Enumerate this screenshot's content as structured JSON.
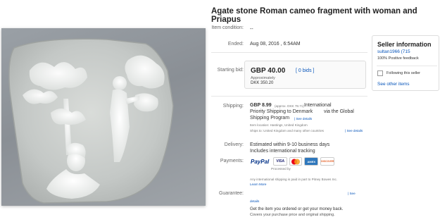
{
  "listing": {
    "title": "Agate stone Roman cameo fragment with woman and Priapus",
    "image_alt": "Agate cameo fragment photo"
  },
  "details": {
    "condition_label": "Item condition:",
    "condition_value": "--",
    "ended_label": "Ended:",
    "ended_value": "Aug 08, 2016 , 6:54AM",
    "starting_bid_label": "Starting bid:",
    "price": "GBP 40.00",
    "approx_label": "Approximately",
    "dkk_price": "DKK 350.20",
    "bids_link": "[ 0 bids ]",
    "shipping_label": "Shipping:",
    "shipping_price": "GBP 8.99",
    "shipping_approx": "(approx. DKK 78.71)",
    "shipping_desc_1": "International",
    "shipping_desc_2": "Priority Shipping to Denmark",
    "shipping_desc_3": "via the Global",
    "shipping_desc_4": "Shipping Program",
    "shipping_details_link": "| See details",
    "item_location": "Item location: Hastings, United Kingdom",
    "ships_to": "Ships to: United Kingdom and many other countries",
    "ships_to_link": "| See details",
    "delivery_label": "Delivery:",
    "delivery_value": "Estimated within 9-10 business days",
    "delivery_tracking": "Includes international tracking",
    "payments_label": "Payments:",
    "paypal": "PayPal",
    "processed_by": "Processed by",
    "pitney_note": "Any international shipping is paid in part to Pitney Bowes Inc.",
    "learn_more": "Learn More",
    "guarantee_label": "Guarantee:",
    "guarantee_see": "| See",
    "guarantee_details": "details",
    "guarantee_text_1": "Get the item you ordered or get your money back.",
    "guarantee_text_2": "Covers your purchase price and original shipping."
  },
  "seller": {
    "title": "Seller information",
    "name": "sultan1966 (715",
    "feedback": "100% Positive feedback",
    "follow_label": "Following this seller",
    "see_other": "See other items"
  },
  "payment_badges": [
    "VISA",
    "MC",
    "AMEX",
    "DISCOVER"
  ],
  "colors": {
    "link": "#0654ba",
    "paypal_blue": "#003087",
    "paypal_light": "#009cde",
    "visa": "#1a1f71",
    "mastercard_red": "#eb001b",
    "mastercard_orange": "#f79e1b",
    "amex": "#2e77bc"
  }
}
